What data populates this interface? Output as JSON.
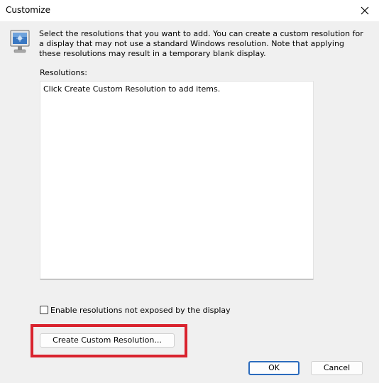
{
  "window": {
    "title": "Customize"
  },
  "icons": {
    "monitor": "monitor-icon",
    "close": "close-icon"
  },
  "description": "Select the resolutions that you want to add. You can create a custom resolution for a display that may not use a standard Windows resolution. Note that applying these resolutions may result in a temporary blank display.",
  "resolutions": {
    "label": "Resolutions:",
    "empty_message": "Click Create Custom Resolution to add items.",
    "items": []
  },
  "checkbox": {
    "label": "Enable resolutions not exposed by the display",
    "checked": false
  },
  "buttons": {
    "create_custom": "Create Custom Resolution...",
    "ok": "OK",
    "cancel": "Cancel"
  },
  "colors": {
    "highlight": "#d9232e",
    "ok_border": "#2b6bbd"
  }
}
